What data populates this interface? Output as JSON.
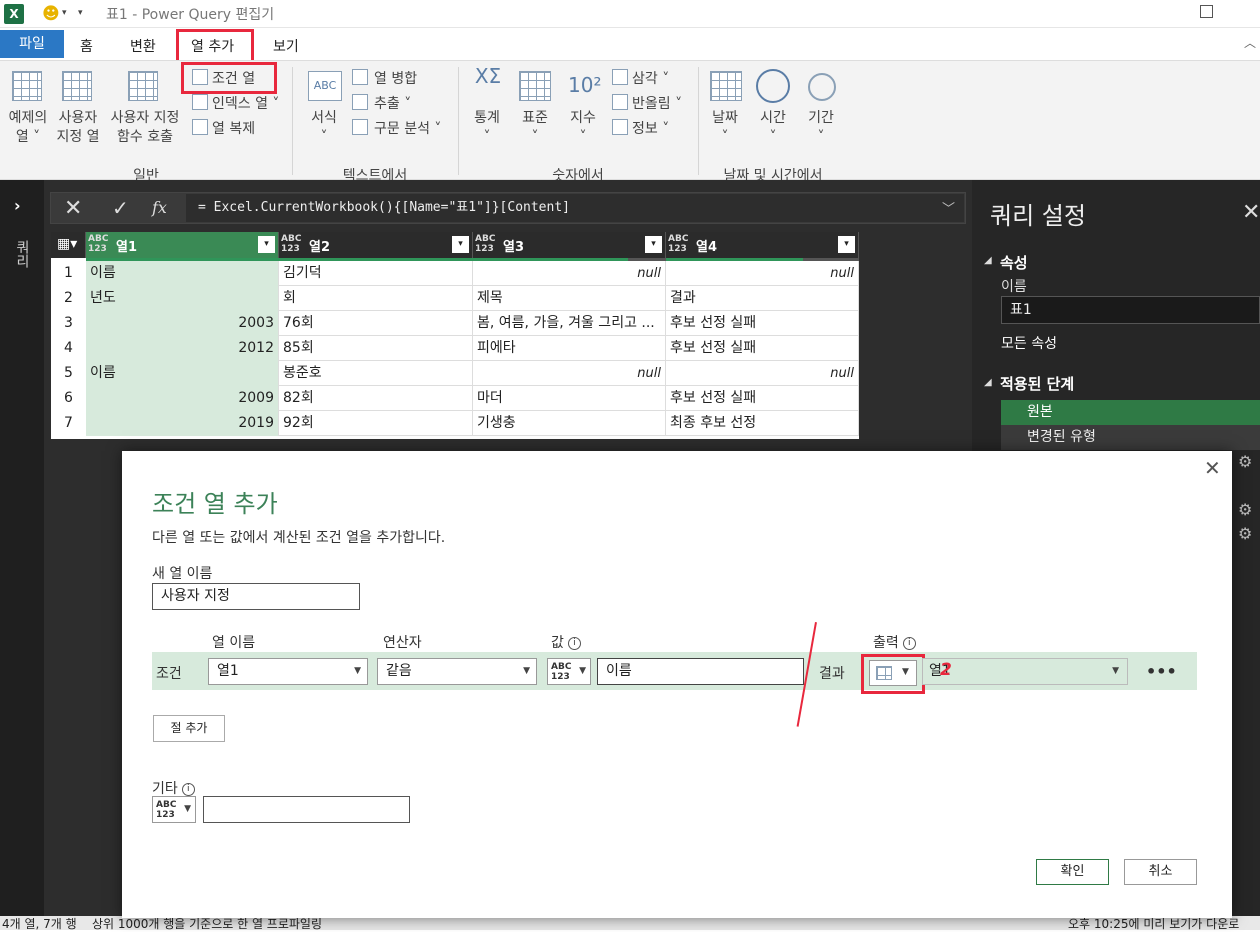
{
  "titlebar": {
    "app_icon": "X",
    "title": "표1 - Power Query 편집기"
  },
  "tabs": {
    "file": "파일",
    "home": "홈",
    "transform": "변환",
    "add_column": "열 추가",
    "view": "보기"
  },
  "ribbon": {
    "example_col": "예제의\n열 ˅",
    "custom_col": "사용자\n지정 열",
    "invoke_fn": "사용자 지정\n함수 호출",
    "cond_col": "조건 열",
    "index_col": "인덱스 열 ˅",
    "dup_col": "열 복제",
    "group_general": "일반",
    "format": "서식\n˅",
    "merge_cols": "열 병합",
    "extract": "추출 ˅",
    "parse": "구문 분석 ˅",
    "group_text": "텍스트에서",
    "statistics": "통계\n˅",
    "standard": "표준\n˅",
    "scientific": "지수\n˅",
    "trig": "삼각 ˅",
    "rounding": "반올림 ˅",
    "info": "정보 ˅",
    "group_number": "숫자에서",
    "date": "날짜\n˅",
    "time": "시간\n˅",
    "duration": "기간\n˅",
    "group_datetime": "날짜 및 시간에서"
  },
  "left_pane": {
    "label": "쿼리"
  },
  "formula": {
    "text": "= Excel.CurrentWorkbook(){[Name=\"표1\"]}[Content]"
  },
  "grid": {
    "type_label": "ABC\n123",
    "columns": [
      "열1",
      "열2",
      "열3",
      "열4"
    ],
    "rows": [
      {
        "n": "1",
        "c1": "이름",
        "c2": "김기덕",
        "c3": "null",
        "c4": "null"
      },
      {
        "n": "2",
        "c1": "년도",
        "c2": "회",
        "c3": "제목",
        "c4": "결과"
      },
      {
        "n": "3",
        "c1": "2003",
        "c2": "76회",
        "c3": "봄, 여름, 가을, 겨울 그리고 ...",
        "c4": "후보 선정 실패"
      },
      {
        "n": "4",
        "c1": "2012",
        "c2": "85회",
        "c3": "피에타",
        "c4": "후보 선정 실패"
      },
      {
        "n": "5",
        "c1": "이름",
        "c2": "봉준호",
        "c3": "null",
        "c4": "null"
      },
      {
        "n": "6",
        "c1": "2009",
        "c2": "82회",
        "c3": "마더",
        "c4": "후보 선정 실패"
      },
      {
        "n": "7",
        "c1": "2019",
        "c2": "92회",
        "c3": "기생충",
        "c4": "최종 후보 선정"
      }
    ]
  },
  "query_settings": {
    "title": "쿼리 설정",
    "properties": "속성",
    "name_label": "이름",
    "name_value": "표1",
    "all_props": "모든 속성",
    "applied_steps": "적용된 단계",
    "steps": [
      "원본",
      "변경된 유형"
    ]
  },
  "status": {
    "left": "4개 열, 7개 행    상위 1000개 행을 기준으로 한 열 프로파일링",
    "right": "오후 10:25에 미리 보기가 다운로"
  },
  "dialog": {
    "title": "조건 열 추가",
    "description": "다른 열 또는 값에서 계산된 조건 열을 추가합니다.",
    "new_col_label": "새 열 이름",
    "new_col_value": "사용자 지정",
    "col_name_header": "열 이름",
    "operator_header": "연산자",
    "value_header": "값",
    "output_header": "출력",
    "clause_label": "조건",
    "col_select": "열1",
    "operator_select": "같음",
    "value_type": "ABC\n123",
    "value_input": "이름",
    "result_label": "결과",
    "output_select": "열1",
    "output_mark": "2",
    "more": "•••",
    "add_clause": "절 추가",
    "else_label": "기타",
    "ok": "확인",
    "cancel": "취소"
  }
}
